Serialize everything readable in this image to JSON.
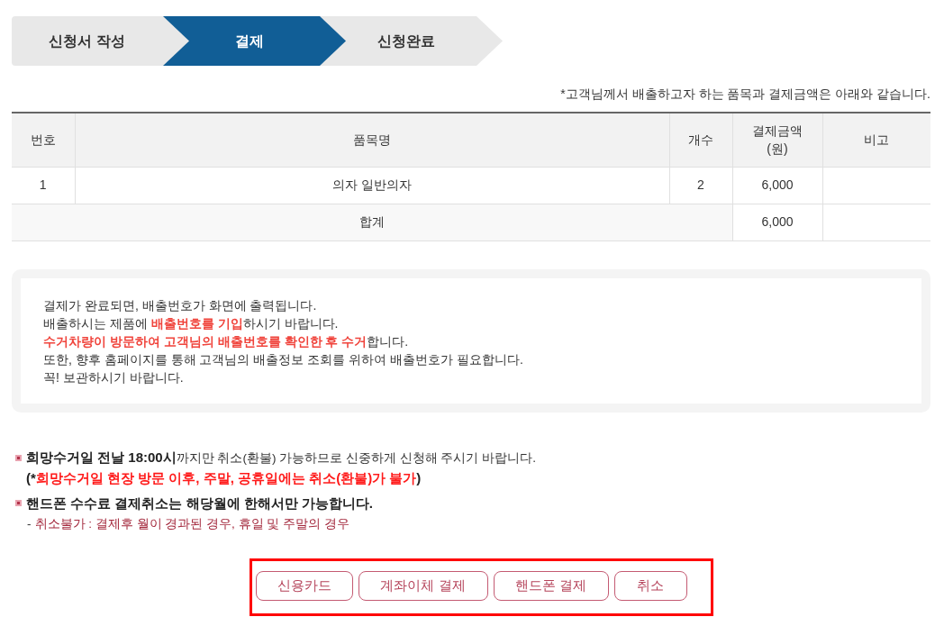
{
  "steps": [
    {
      "label": "신청서 작성",
      "selected": false
    },
    {
      "label": "결제",
      "selected": true
    },
    {
      "label": "신청완료",
      "selected": false
    }
  ],
  "notice": "*고객님께서 배출하고자 하는 품목과 결제금액은 아래와 같습니다.",
  "table": {
    "columns": [
      "번호",
      "품목명",
      "개수",
      "결제금액\n(원)",
      "비고"
    ],
    "rows": [
      {
        "number": "1",
        "item": "의자 일반의자",
        "quantity": "2",
        "amount": "6,000"
      }
    ],
    "total": {
      "label": "합계",
      "amount": "6,000"
    }
  },
  "info_box": {
    "lines": [
      [
        {
          "text": "결제가 완료되면, 배출번호가 화면에 출력됩니다.",
          "highlight": false
        }
      ],
      [
        {
          "text": "배출하시는 제품에 ",
          "highlight": false
        },
        {
          "text": "배출번호를 기입",
          "highlight": true
        },
        {
          "text": "하시기 바랍니다.",
          "highlight": false
        }
      ],
      [
        {
          "text": "수거차량이 방문하여 고객님의 배출번호를 확인한 후 수거",
          "highlight": true
        },
        {
          "text": "합니다.",
          "highlight": false
        }
      ],
      [
        {
          "text": "또한, 향후 홈페이지를 통해 고객님의 배출정보 조회를 위하여 배출번호가 필요합니다.",
          "highlight": false
        }
      ],
      [
        {
          "text": "꼭! 보관하시기 바랍니다.",
          "highlight": false
        }
      ]
    ]
  },
  "notes": [
    {
      "kind": "bullet",
      "text": "**희망수거일 전날 18:00시**까지만 취소(환불) 가능하므로 신중하게 신청해 주시기 바랍니다."
    },
    {
      "kind": "alert",
      "segments": [
        {
          "text": "(*",
          "highlight": false
        },
        {
          "text": "희망수거일 현장 방문 이후, 주말, 공휴일에는 취소(환불)가 불가",
          "highlight": true
        },
        {
          "text": ")",
          "highlight": false
        }
      ]
    },
    {
      "kind": "heading",
      "text": "핸드폰 수수료 결제취소는 해당월에 한해서만 가능합니다."
    },
    {
      "kind": "sub",
      "segments": [
        {
          "text": "-",
          "highlight": false
        },
        {
          "text": "취소불가 : 결제후 월이 경과된 경우, 휴일 및 주말의 경우",
          "highlight": true
        }
      ]
    }
  ],
  "button_bar": {
    "highlighted": true,
    "buttons": [
      "신용카드",
      "계좌이체 결제",
      "핸드폰 결제",
      "취소"
    ]
  }
}
